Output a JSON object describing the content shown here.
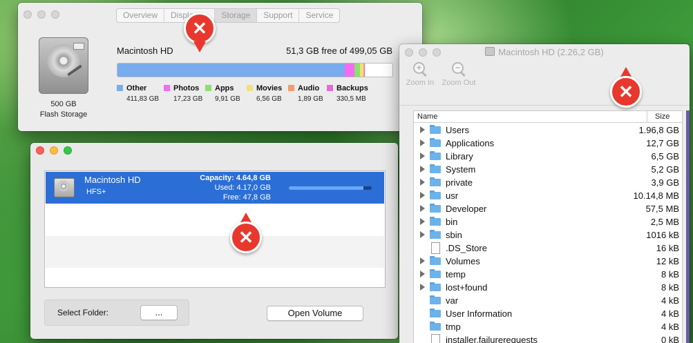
{
  "about": {
    "tabs": [
      "Overview",
      "Displays",
      "Storage",
      "Support",
      "Service"
    ],
    "selected_tab": "Storage",
    "tab_visible_text": [
      "Overview",
      "Displa",
      "Storage",
      "Support",
      "Service"
    ],
    "capacity": "500 GB",
    "type": "Flash Storage",
    "disk_name": "Macintosh HD",
    "free_text": "51,3 GB free of 499,05 GB",
    "legend": [
      {
        "name": "Other",
        "size": "411,83 GB",
        "color": "#78acec",
        "fraction": 0.826
      },
      {
        "name": "Photos",
        "size": "17,23 GB",
        "color": "#f36bf0",
        "fraction": 0.035
      },
      {
        "name": "Apps",
        "size": "9,91 GB",
        "color": "#8de06e",
        "fraction": 0.02
      },
      {
        "name": "Movies",
        "size": "6,56 GB",
        "color": "#f2e07a",
        "fraction": 0.013
      },
      {
        "name": "Audio",
        "size": "1,89 GB",
        "color": "#f59a6c",
        "fraction": 0.004
      },
      {
        "name": "Backups",
        "size": "330,5 MB",
        "color": "#e86ad8",
        "fraction": 0.001
      }
    ]
  },
  "chooser": {
    "volume_name": "Macintosh HD",
    "filesystem": "HFS+",
    "capacity": "Capacity: 4.64,8 GB",
    "used": "Used: 4.17,0 GB",
    "free": "Free: 47,8 GB",
    "used_fraction": 0.9,
    "select_folder_label": "Select Folder:",
    "browse_label": "...",
    "open_label": "Open Volume"
  },
  "inventory": {
    "title": "Macintosh HD (2.26,2 GB)",
    "zoom_in": "Zoom In",
    "zoom_out": "Zoom Out",
    "col_name": "Name",
    "col_size": "Size",
    "rows": [
      {
        "name": "Users",
        "size": "1.96,8 GB",
        "kind": "folder",
        "expandable": true
      },
      {
        "name": "Applications",
        "size": "12,7 GB",
        "kind": "folder",
        "expandable": true
      },
      {
        "name": "Library",
        "size": "6,5 GB",
        "kind": "folder",
        "expandable": true
      },
      {
        "name": "System",
        "size": "5,2 GB",
        "kind": "folder",
        "expandable": true
      },
      {
        "name": "private",
        "size": "3,9 GB",
        "kind": "folder",
        "expandable": true
      },
      {
        "name": "usr",
        "size": "10.14,8 MB",
        "kind": "folder",
        "expandable": true
      },
      {
        "name": "Developer",
        "size": "57,5 MB",
        "kind": "folder",
        "expandable": true
      },
      {
        "name": "bin",
        "size": "2,5 MB",
        "kind": "folder",
        "expandable": true
      },
      {
        "name": "sbin",
        "size": "1016 kB",
        "kind": "folder",
        "expandable": true
      },
      {
        "name": ".DS_Store",
        "size": "16 kB",
        "kind": "file",
        "expandable": false
      },
      {
        "name": "Volumes",
        "size": "12 kB",
        "kind": "folder",
        "expandable": true
      },
      {
        "name": "temp",
        "size": "8 kB",
        "kind": "folder",
        "expandable": true
      },
      {
        "name": "lost+found",
        "size": "8 kB",
        "kind": "folder",
        "expandable": true
      },
      {
        "name": "var",
        "size": "4 kB",
        "kind": "folder",
        "expandable": false
      },
      {
        "name": "User Information",
        "size": "4 kB",
        "kind": "folder",
        "expandable": false
      },
      {
        "name": "tmp",
        "size": "4 kB",
        "kind": "folder",
        "expandable": false
      },
      {
        "name": "installer.failurerequests",
        "size": "0 kB",
        "kind": "file",
        "expandable": false
      }
    ]
  },
  "badges": {
    "symbol": "✕"
  }
}
